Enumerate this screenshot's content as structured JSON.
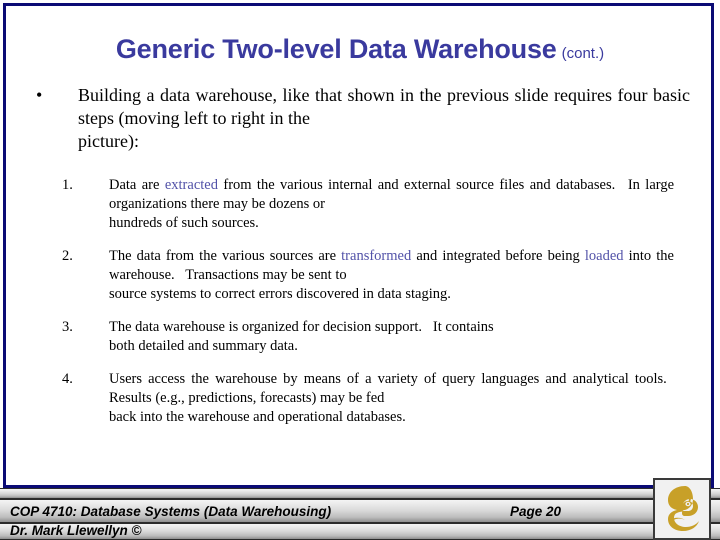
{
  "slide": {
    "title_main": "Generic Two-level Data Warehouse",
    "title_cont": "(cont.)",
    "title_color": "#3a3a9e",
    "border_color": "#0b0b75",
    "keyword_color": "#5252a8",
    "logo_color": "#c8a028"
  },
  "bullet": {
    "marker": "•",
    "line1": "Building a data warehouse, like that shown in the previous",
    "line2": "slide requires four basic steps (moving left to right in the",
    "line3": "picture):"
  },
  "steps": [
    {
      "marker": "1.",
      "line1_a": "Data are ",
      "line1_kw": "extracted",
      "line1_b": " from the various internal and external source files",
      "line2": "and databases.  In large organizations there may be dozens or",
      "line3": "hundreds of such sources."
    },
    {
      "marker": "2.",
      "line1_a": "The data from the various sources are ",
      "line1_kw": "transformed",
      "line1_b": " and integrated",
      "line2_a": "before being ",
      "line2_kw": "loaded",
      "line2_b": " into the warehouse.  Transactions may be sent to",
      "line3": "source systems to correct errors discovered in data staging."
    },
    {
      "marker": "3.",
      "line1": "The data warehouse is organized for decision support.  It contains",
      "line2": "both detailed and summary data."
    },
    {
      "marker": "4.",
      "line1": "Users access the warehouse by means of a variety of query languages",
      "line2": "and analytical tools.  Results (e.g., predictions, forecasts) may be fed",
      "line3": "back into the warehouse and operational databases."
    }
  ],
  "footer": {
    "course": "COP 4710: Database Systems  (Data Warehousing)",
    "page": "Page 20",
    "author": "Dr. Mark Llewellyn ©"
  }
}
